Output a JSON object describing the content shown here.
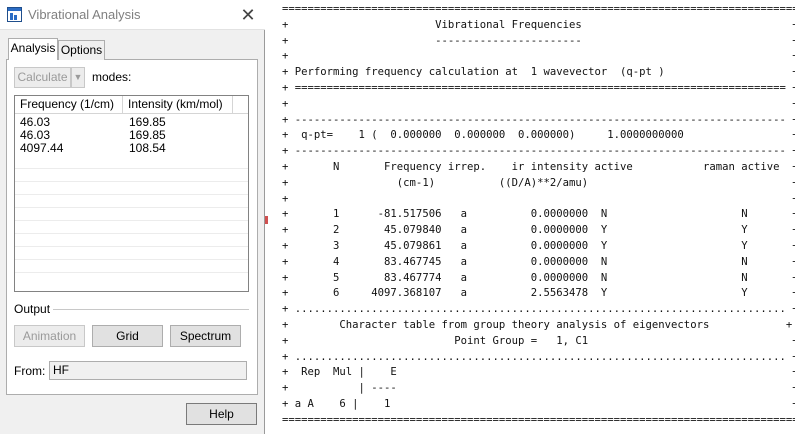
{
  "window": {
    "title": "Vibrational Analysis",
    "close_glyph": "✕"
  },
  "tabs": [
    {
      "label": "Analysis",
      "active": true
    },
    {
      "label": "Options",
      "active": false
    }
  ],
  "calculate": {
    "label": "Calculate",
    "dropdown_glyph": "▼",
    "modes_label": "modes:"
  },
  "table": {
    "columns": [
      "Frequency (1/cm)",
      "Intensity (km/mol)"
    ],
    "rows": [
      {
        "frequency": "46.03",
        "intensity": "169.85"
      },
      {
        "frequency": "46.03",
        "intensity": "169.85"
      },
      {
        "frequency": "4097.44",
        "intensity": "108.54"
      }
    ]
  },
  "output": {
    "label": "Output",
    "animation_label": "Animation",
    "grid_label": "Grid",
    "spectrum_label": "Spectrum",
    "from_label": "From:",
    "from_value": "HF"
  },
  "help_label": "Help",
  "console": {
    "lines": [
      "=================================================================================",
      "+                       Vibrational Frequencies                                 +",
      "+                       -----------------------                                 +",
      "+                                                                               +",
      "+ Performing frequency calculation at  1 wavevector  (q-pt )                    +",
      "+ ============================================================================= +",
      "+                                                                               +",
      "+ ----------------------------------------------------------------------------- +",
      "+  q-pt=    1 (  0.000000  0.000000  0.000000)     1.0000000000                 +",
      "+ ----------------------------------------------------------------------------- +",
      "+       N       Frequency irrep.    ir intensity active           raman active  +",
      "+                 (cm-1)          ((D/A)**2/amu)                                +",
      "+                                                                               +",
      "+       1      -81.517506   a          0.0000000  N                     N       +",
      "+       2       45.079840   a          0.0000000  Y                     Y       +",
      "+       3       45.079861   a          0.0000000  Y                     Y       +",
      "+       4       83.467745   a          0.0000000  N                     N       +",
      "+       5       83.467774   a          0.0000000  N                     N       +",
      "+       6     4097.368107   a          2.5563478  Y                     Y       +",
      "+ ............................................................................. +",
      "+        Character table from group theory analysis of eigenvectors            +",
      "+                          Point Group =   1, C1                                +",
      "+ ............................................................................. +",
      "+  Rep  Mul |    E                                                              +",
      "+           | ----                                                              +",
      "+ a A    6 |    1                                                               +",
      "================================================================================="
    ]
  }
}
